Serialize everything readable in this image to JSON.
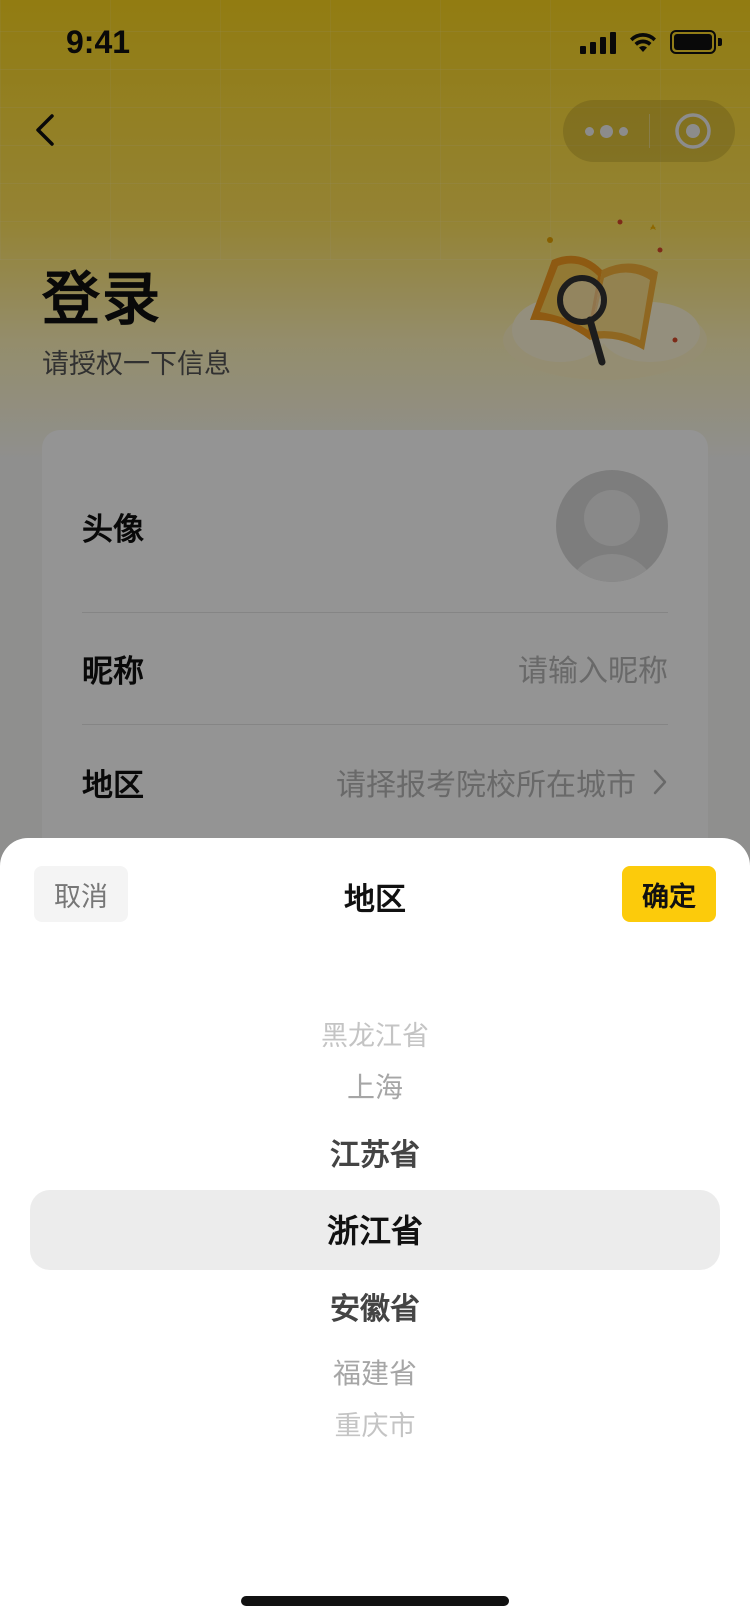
{
  "status_bar": {
    "time": "9:41"
  },
  "page": {
    "title": "登录",
    "subtitle": "请授权一下信息"
  },
  "form": {
    "avatar_label": "头像",
    "nickname_label": "昵称",
    "nickname_placeholder": "请输入昵称",
    "region_label": "地区",
    "region_placeholder": "请择报考院校所在城市"
  },
  "sheet": {
    "cancel_label": "取消",
    "title": "地区",
    "confirm_label": "确定",
    "options": [
      "黑龙江省",
      "上海",
      "江苏省",
      "浙江省",
      "安徽省",
      "福建省",
      "重庆市"
    ],
    "selected": "浙江省"
  },
  "colors": {
    "accent": "#fccb0b",
    "header_gradient_top": "#fbd61f"
  },
  "icons": [
    "back-arrow-icon",
    "more-dots-icon",
    "close-target-icon",
    "book-magnifier-illustration",
    "chevron-right-icon"
  ]
}
